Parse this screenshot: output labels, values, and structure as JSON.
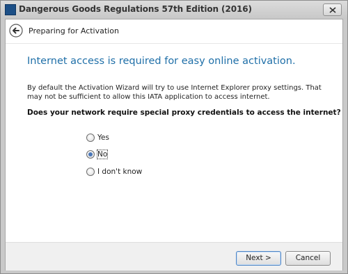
{
  "window": {
    "title": "Dangerous Goods Regulations 57th Edition (2016)",
    "close_icon": "close-icon",
    "app_icon": "iata-logo-icon"
  },
  "header": {
    "page_title": "Preparing for Activation",
    "back_icon": "back-arrow-icon"
  },
  "content": {
    "heading": "Internet access is required for easy online activation.",
    "description": "By default the Activation Wizard will try to use Internet Explorer proxy settings. That may not be sufficient to allow this IATA application to access internet.",
    "question": "Does your network require special proxy credentials to access the internet?",
    "options": [
      {
        "label": "Yes",
        "selected": false
      },
      {
        "label": "No",
        "selected": true
      },
      {
        "label": "I don't know",
        "selected": false
      }
    ]
  },
  "footer": {
    "next_label": "Next >",
    "cancel_label": "Cancel"
  },
  "colors": {
    "heading": "#1f6fa8",
    "titlebar": "#d2d2d2",
    "footer": "#f0f0f0"
  }
}
